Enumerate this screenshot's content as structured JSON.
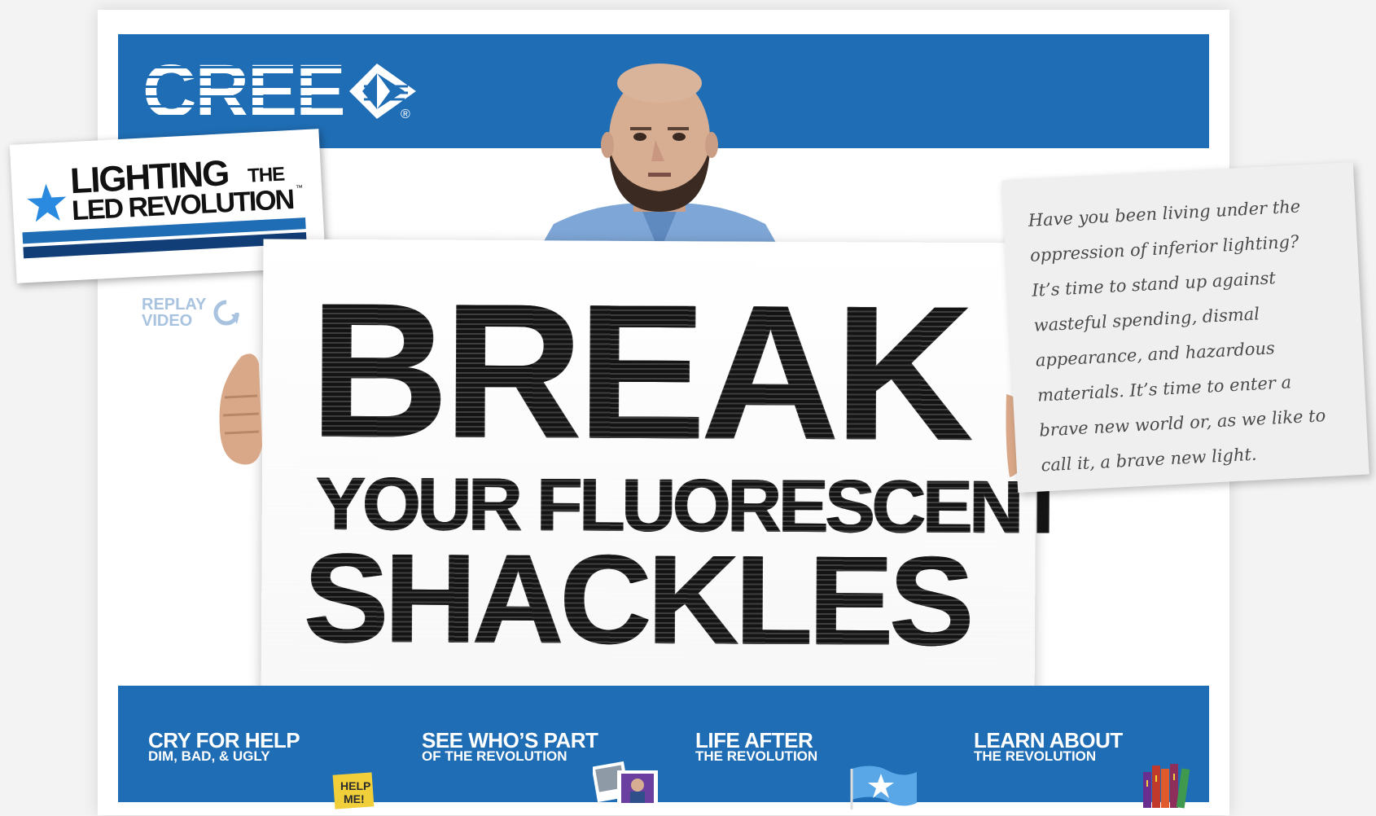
{
  "brand": {
    "logo_text": "CREE",
    "reg_mark": "®"
  },
  "badge": {
    "line1": "LIGHTING",
    "the": "THE",
    "line2": "LED REVOLUTION",
    "tm": "™"
  },
  "replay": {
    "label_line1": "REPLAY",
    "label_line2": "VIDEO"
  },
  "sign": {
    "line1": "BREAK",
    "line2": "YOUR FLUORESCENT",
    "line3": "SHACKLES"
  },
  "note": {
    "text": "Have you been living under the oppression of inferior lighting? It’s time to stand up against wasteful spending, dismal appearance, and hazardous materials. It’s time to enter a brave new world or, as we like to call it, a brave new light."
  },
  "nav": [
    {
      "title": "CRY FOR HELP",
      "subtitle": "DIM, BAD, & UGLY",
      "icon": "help-me-note-icon",
      "icon_text": "HELP ME!"
    },
    {
      "title": "SEE WHO’S PART",
      "subtitle": "OF THE REVOLUTION",
      "icon": "photos-icon"
    },
    {
      "title": "LIFE AFTER",
      "subtitle": "THE REVOLUTION",
      "icon": "star-flag-icon"
    },
    {
      "title": "LEARN ABOUT",
      "subtitle": "THE REVOLUTION",
      "icon": "books-icon"
    }
  ],
  "colors": {
    "brand_blue": "#1f6db4",
    "dark_blue": "#123e78",
    "light_blue_text": "#a8c3df"
  }
}
